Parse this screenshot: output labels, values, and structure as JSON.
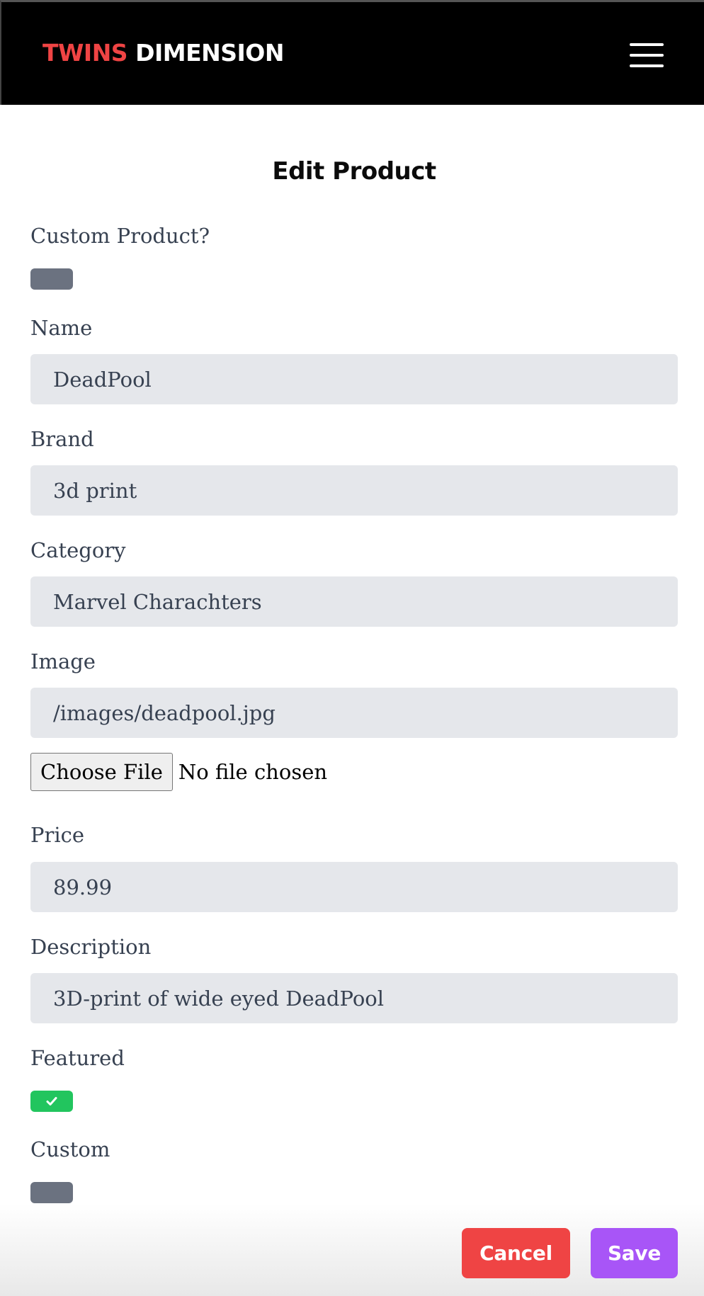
{
  "header": {
    "brand_accent": "TWINS",
    "brand_rest": "DIMENSION",
    "menu_icon": "hamburger-menu-icon"
  },
  "form": {
    "title": "Edit Product",
    "custom_product_label": "Custom Product?",
    "custom_product_value": false,
    "name_label": "Name",
    "name_value": "DeadPool",
    "brand_label": "Brand",
    "brand_value": "3d print",
    "category_label": "Category",
    "category_value": "Marvel Charachters",
    "image_label": "Image",
    "image_value": "/images/deadpool.jpg",
    "choose_file_label": "Choose File",
    "file_status": "No file chosen",
    "price_label": "Price",
    "price_value": "89.99",
    "description_label": "Description",
    "description_value": "3D-print of wide eyed DeadPool",
    "featured_label": "Featured",
    "featured_value": true,
    "custom_label": "Custom",
    "custom_value": false
  },
  "actions": {
    "cancel_label": "Cancel",
    "save_label": "Save"
  },
  "colors": {
    "brand_accent": "#ef4444",
    "toggle_off": "#6b7280",
    "toggle_on": "#22c55e",
    "cancel": "#ef4444",
    "save": "#a855f7",
    "field_bg": "#e5e7eb"
  }
}
